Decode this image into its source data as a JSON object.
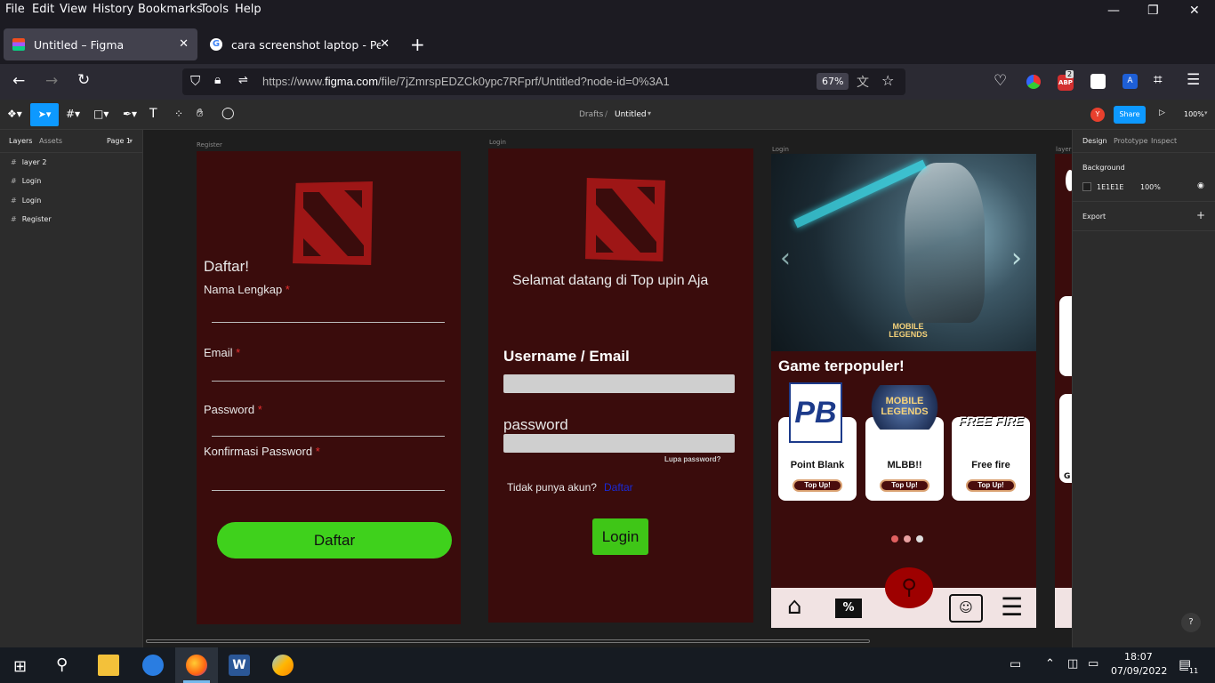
{
  "menu": [
    "File",
    "Edit",
    "View",
    "History",
    "Bookmarks",
    "Tools",
    "Help"
  ],
  "tabs": [
    {
      "title": "Untitled – Figma",
      "active": true
    },
    {
      "title": "cara screenshot laptop - Penelu",
      "active": false
    }
  ],
  "url": {
    "prefix": "https://www.",
    "domain": "figma.com",
    "path": "/file/7jZmrspEDZCk0ypc7RFprf/Untitled?node-id=0%3A1"
  },
  "zoom_badge": "67%",
  "abp_count": "2",
  "figma": {
    "breadcrumb_drafts": "Drafts",
    "breadcrumb_sep": "/",
    "file_name": "Untitled",
    "avatar": "Y",
    "share": "Share",
    "zoom": "100%"
  },
  "left_panel": {
    "tab_layers": "Layers",
    "tab_assets": "Assets",
    "page": "Page 1",
    "layers": [
      "layer 2",
      "Login",
      "Login",
      "Register"
    ]
  },
  "right_panel": {
    "tab_design": "Design",
    "tab_prototype": "Prototype",
    "tab_inspect": "Inspect",
    "background_label": "Background",
    "bg_hex": "1E1E1E",
    "bg_opacity": "100%",
    "export_label": "Export"
  },
  "frames": {
    "register": {
      "label": "Register",
      "heading": "Daftar!",
      "fields": [
        "Nama Lengkap",
        "Email",
        "Password",
        "Konfirmasi Password"
      ],
      "required_mark": "*",
      "button": "Daftar"
    },
    "login": {
      "label": "Login",
      "welcome": "Selamat datang di Top upin Aja",
      "username_label": "Username / Email",
      "password_label": "password",
      "forgot": "Lupa password?",
      "no_account": "Tidak punya akun?",
      "signup_link": "Daftar",
      "button": "Login"
    },
    "home": {
      "label": "Login",
      "banner_logo": "MOBILE LEGENDS",
      "section_title": "Game terpopuler!",
      "cards": [
        {
          "name": "Point Blank",
          "logo": "PB",
          "button": "Top Up!"
        },
        {
          "name": "MLBB!!",
          "logo": "MOBILE LEGENDS",
          "button": "Top Up!"
        },
        {
          "name": "Free fire",
          "logo": "FREE FIRE",
          "button": "Top Up!"
        }
      ]
    },
    "fourth": {
      "label": "layer",
      "partial": "G"
    }
  },
  "taskbar": {
    "time": "18:07",
    "date": "07/09/2022",
    "notif_count": "11"
  },
  "help_btn": "?"
}
